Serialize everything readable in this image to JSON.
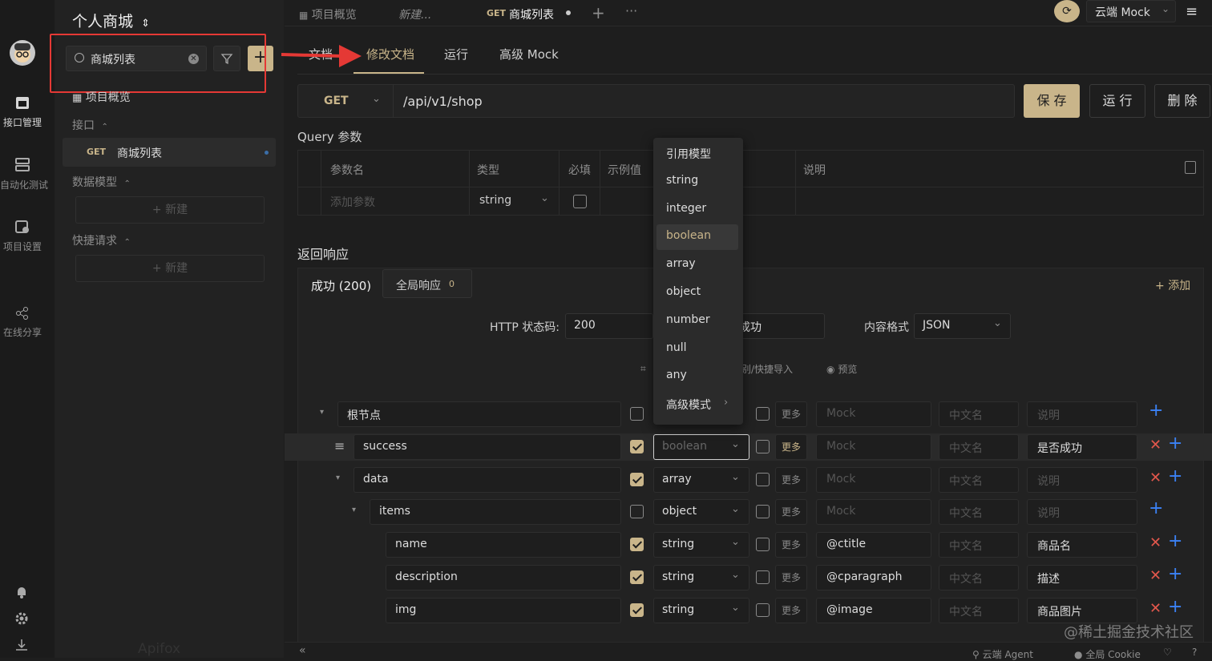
{
  "project": {
    "name": "个人商城"
  },
  "rail": {
    "items": [
      "接口管理",
      "自动化测试",
      "项目设置",
      "在线分享"
    ]
  },
  "search": {
    "value": "商城列表"
  },
  "sidebar": {
    "overview": "项目概览",
    "api_section": "接口",
    "api_item_method": "GET",
    "api_item_name": "商城列表",
    "model_section": "数据模型",
    "new_label": "新建",
    "quick_section": "快捷请求",
    "new_label2": "新建",
    "logo": "Apifox"
  },
  "tabs": {
    "overview": "项目概览",
    "new": "新建...",
    "active_method": "GET",
    "active_name": "商城列表"
  },
  "topbar": {
    "env": "云端 Mock"
  },
  "subtabs": [
    "文档",
    "修改文档",
    "运行",
    "高级 Mock"
  ],
  "request": {
    "method": "GET",
    "url": "/api/v1/shop",
    "save": "保 存",
    "run": "运 行",
    "delete": "删 除"
  },
  "query": {
    "title": "Query 参数",
    "headers": [
      "参数名",
      "类型",
      "必填",
      "示例值",
      "说明"
    ],
    "placeholder": "添加参数",
    "type": "string"
  },
  "dropdown": {
    "options": [
      "引用模型",
      "string",
      "integer",
      "boolean",
      "array",
      "object",
      "number",
      "null",
      "any",
      "高级模式"
    ],
    "selected": "boolean"
  },
  "response": {
    "title": "返回响应",
    "tab_success": "成功 (200)",
    "tab_global": "全局响应",
    "tab_global_count": "0",
    "add": "添加",
    "status_label": "HTTP 状态码:",
    "status_value": "200",
    "name_value": "成功",
    "format_label": "内容格式",
    "format_value": "JSON",
    "import_label": "别/快捷导入",
    "preview_label": "预览"
  },
  "schema": {
    "more": "更多",
    "ph_mock": "Mock",
    "ph_cn": "中文名",
    "ph_desc": "说明",
    "rows": [
      {
        "name": "根节点",
        "type": "",
        "mock": "",
        "desc": "",
        "checked": false
      },
      {
        "name": "success",
        "type": "boolean",
        "mock": "",
        "desc": "是否成功",
        "checked": true
      },
      {
        "name": "data",
        "type": "array",
        "mock": "",
        "desc": "",
        "checked": true
      },
      {
        "name": "items",
        "type": "object",
        "mock": "",
        "desc": "",
        "checked": false
      },
      {
        "name": "name",
        "type": "string",
        "mock": "@ctitle",
        "desc": "商品名",
        "checked": true
      },
      {
        "name": "description",
        "type": "string",
        "mock": "@cparagraph",
        "desc": "描述",
        "checked": true
      },
      {
        "name": "img",
        "type": "string",
        "mock": "@image",
        "desc": "商品图片",
        "checked": true
      }
    ]
  },
  "statusbar": {
    "agent": "云端 Agent",
    "cookie": "全局 Cookie"
  },
  "watermark": "@稀土掘金技术社区",
  "colors": {
    "accent": "#c9b58a",
    "annotation": "#e53935",
    "blue": "#3b82f6",
    "red": "#e2574c"
  }
}
